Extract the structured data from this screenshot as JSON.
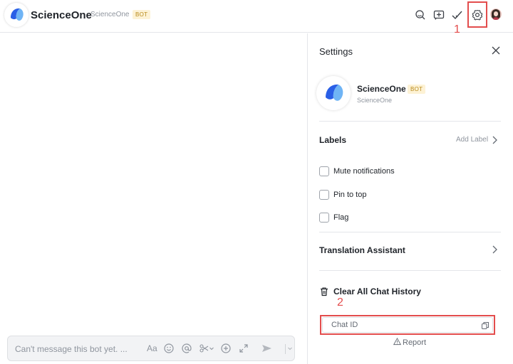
{
  "header": {
    "title": "ScienceOne",
    "subtitle": "ScienceOne",
    "badge": "BOT",
    "icons": [
      "search-icon",
      "share-chat-icon",
      "done-check-icon",
      "settings-gear-icon",
      "user-avatar"
    ],
    "annotation_1": "1"
  },
  "composer": {
    "placeholder": "Can't message this bot yet. ...",
    "format_label": "Aa",
    "tools": [
      "text-format-icon",
      "emoji-icon",
      "mention-icon",
      "scissors-icon",
      "add-icon",
      "expand-icon",
      "send-icon",
      "chevron-down-icon"
    ]
  },
  "settings": {
    "title": "Settings",
    "bot": {
      "name": "ScienceOne",
      "badge": "BOT",
      "subtitle": "ScienceOne"
    },
    "labels": {
      "title": "Labels",
      "add_label": "Add Label"
    },
    "options": [
      {
        "label": "Mute notifications",
        "checked": false
      },
      {
        "label": "Pin to top",
        "checked": false
      },
      {
        "label": "Flag",
        "checked": false
      }
    ],
    "translation": {
      "title": "Translation Assistant"
    },
    "clear_history": "Clear All Chat History",
    "annotation_2": "2",
    "chat_id_label": "Chat ID",
    "report": "Report"
  },
  "colors": {
    "annotation_red": "#e34d4d",
    "brand_blue": "#3370ff",
    "badge_bg": "#fdf2d5",
    "badge_text": "#b88a1b"
  }
}
